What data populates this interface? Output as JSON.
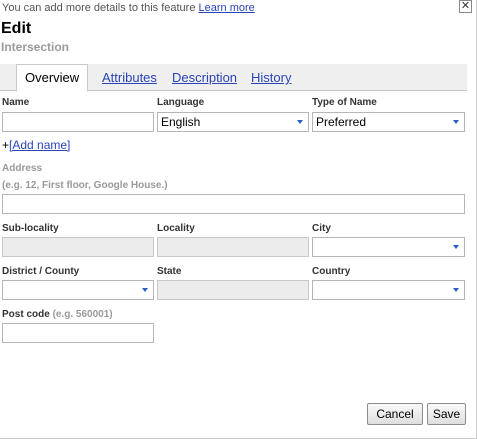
{
  "header": {
    "note": "You can add more details to this feature",
    "learn_more": "Learn more",
    "close_glyph": "✕",
    "title": "Edit",
    "subtitle": "Intersection"
  },
  "tabs": [
    {
      "label": "Overview",
      "active": true
    },
    {
      "label": "Attributes",
      "active": false
    },
    {
      "label": "Description",
      "active": false
    },
    {
      "label": "History",
      "active": false
    }
  ],
  "form": {
    "name": {
      "label": "Name",
      "value": ""
    },
    "language": {
      "label": "Language",
      "value": "English"
    },
    "type_of_name": {
      "label": "Type of Name",
      "value": "Preferred"
    },
    "add_name": {
      "prefix": "+",
      "link": "[Add name]"
    },
    "address": {
      "label": "Address",
      "hint": "(e.g. 12, First floor, Google House.)",
      "value": ""
    },
    "sub_locality": {
      "label": "Sub-locality",
      "value": ""
    },
    "locality": {
      "label": "Locality",
      "value": ""
    },
    "city": {
      "label": "City",
      "value": ""
    },
    "district": {
      "label": "District / County",
      "value": ""
    },
    "state": {
      "label": "State",
      "value": ""
    },
    "country": {
      "label": "Country",
      "value": ""
    },
    "post_code": {
      "label": "Post code",
      "hint": "(e.g. 560001)",
      "value": ""
    }
  },
  "buttons": {
    "cancel": "Cancel",
    "save": "Save"
  }
}
